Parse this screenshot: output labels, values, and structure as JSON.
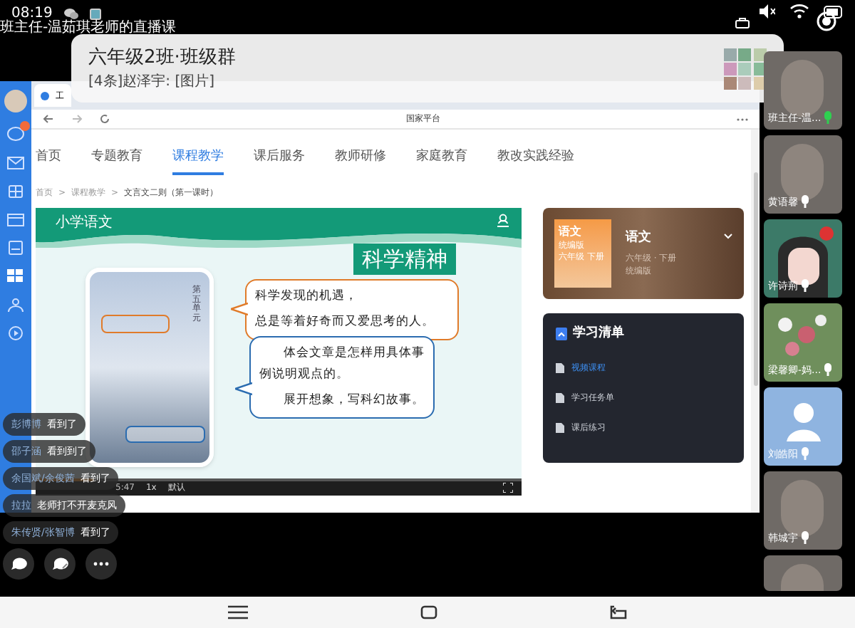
{
  "status_bar": {
    "time": "08:19"
  },
  "live_title": "班主任-温茹琪老师的直播课",
  "notification": {
    "title": "六年级2班·班级群",
    "message": "[4条]赵泽宇: [图片]"
  },
  "browser": {
    "tab": "工",
    "page_title": "国家平台",
    "nav": [
      {
        "label": "首页",
        "selected": false
      },
      {
        "label": "专题教育",
        "selected": false
      },
      {
        "label": "课程教学",
        "selected": true
      },
      {
        "label": "课后服务",
        "selected": false
      },
      {
        "label": "教师研修",
        "selected": false
      },
      {
        "label": "家庭教育",
        "selected": false
      },
      {
        "label": "教改实践经验",
        "selected": false
      }
    ],
    "breadcrumb_separator": ">",
    "breadcrumb": [
      "首页",
      "课程教学",
      "文言文二则（第一课时）"
    ]
  },
  "slide": {
    "banner": "小学语文",
    "heading": "科学精神",
    "unit": "第五单元",
    "bubbles": [
      {
        "color": "#e07b2a",
        "paragraphs": [
          "科学发现的机遇，",
          "总是等着好奇而又爱思考的人。"
        ]
      },
      {
        "color": "#2b6cb0",
        "paragraphs": [
          "体会文章是怎样用具体事例说明观点的。",
          "展开想象，写科幻故事。"
        ]
      }
    ]
  },
  "player": {
    "level": 0.12,
    "time": "5:47",
    "speed": "1x",
    "quality": "默认"
  },
  "course_card": {
    "cover_title": "语文",
    "cover_lines": [
      "统编版",
      "六年级 下册"
    ],
    "title": "语文",
    "lines": [
      "六年级 · 下册",
      "统编版"
    ]
  },
  "study_list": {
    "title": "学习清单",
    "items": [
      {
        "label": "视频课程",
        "selected": true
      },
      {
        "label": "学习任务单",
        "selected": false
      },
      {
        "label": "课后练习",
        "selected": false
      }
    ]
  },
  "participants": [
    {
      "name": "班主任-温...",
      "kind": "photo",
      "speaking": true
    },
    {
      "name": "黄语馨",
      "kind": "photo",
      "speaking": false
    },
    {
      "name": "许诗荊",
      "kind": "cartoon",
      "speaking": false
    },
    {
      "name": "梁馨卿-妈...",
      "kind": "flowers",
      "speaking": false
    },
    {
      "name": "刘皓阳",
      "kind": "default",
      "speaking": false
    },
    {
      "name": "韩城宇",
      "kind": "photo",
      "speaking": false
    },
    {
      "kind": "photo"
    }
  ],
  "chat": [
    {
      "name": "彭博博",
      "text": "看到了"
    },
    {
      "name": "邵子涵",
      "text": "看到到了"
    },
    {
      "name": "余国斌/余俊茜",
      "text": "看到了"
    },
    {
      "name": "拉拉",
      "text": "老师打不开麦克风"
    },
    {
      "name": "朱传贤/张智博",
      "text": "看到了"
    }
  ]
}
